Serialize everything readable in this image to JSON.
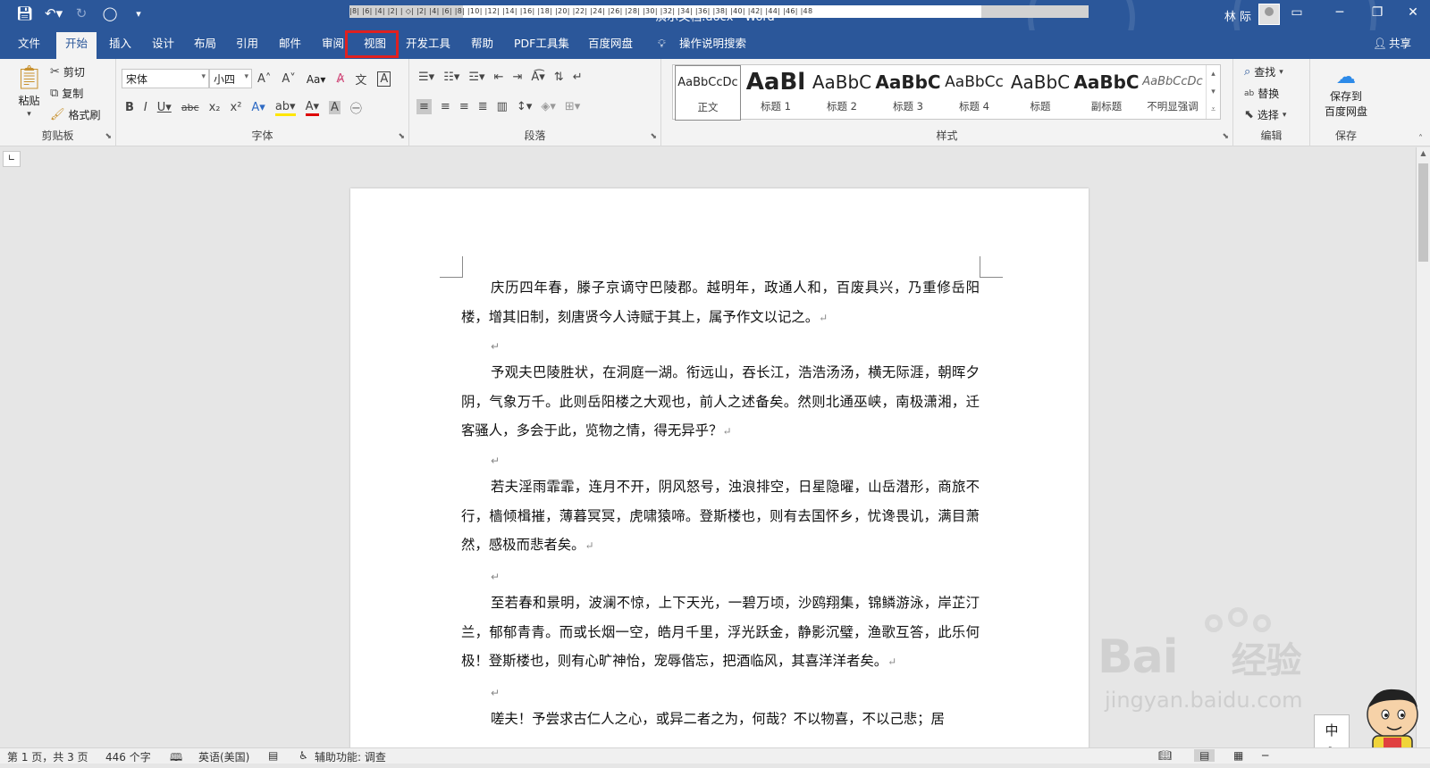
{
  "titlebar": {
    "doc_title": "演示文档.docx  -  Word",
    "user": "林 际",
    "qat_icons": [
      "save-icon",
      "undo-icon",
      "redo-icon",
      "circle-icon",
      "customize-icon"
    ],
    "window_icons": [
      "ribbon-display-icon",
      "minimize-icon",
      "restore-icon",
      "close-icon"
    ]
  },
  "tabs": {
    "items": [
      "文件",
      "开始",
      "插入",
      "设计",
      "布局",
      "引用",
      "邮件",
      "审阅",
      "视图",
      "开发工具",
      "帮助",
      "PDF工具集",
      "百度网盘"
    ],
    "active": "开始",
    "highlighted": "视图",
    "tell_me": "操作说明搜索",
    "share": "共享"
  },
  "clipboard": {
    "paste": "粘贴",
    "cut": "剪切",
    "copy": "复制",
    "format_painter": "格式刷",
    "label": "剪贴板"
  },
  "font": {
    "name": "宋体",
    "size": "小四",
    "change_case": "Aa",
    "label": "字体"
  },
  "paragraph": {
    "label": "段落"
  },
  "styles": {
    "label": "样式",
    "items": [
      {
        "preview": "AaBbCcDc",
        "name": "正文",
        "selected": true
      },
      {
        "preview": "AaBl",
        "name": "标题 1"
      },
      {
        "preview": "AaBbC",
        "name": "标题 2"
      },
      {
        "preview": "AaBbC",
        "name": "标题 3"
      },
      {
        "preview": "AaBbCc",
        "name": "标题 4"
      },
      {
        "preview": "AaBbC",
        "name": "标题"
      },
      {
        "preview": "AaBbC",
        "name": "副标题"
      },
      {
        "preview": "AaBbCcDc",
        "name": "不明显强调"
      }
    ]
  },
  "editing": {
    "find": "查找",
    "replace": "替换",
    "select": "选择",
    "label": "编辑"
  },
  "save": {
    "button": "保存到\n百度网盘",
    "button_line1": "保存到",
    "button_line2": "百度网盘",
    "label": "保存"
  },
  "ruler": {
    "ticks": "|8|  |6|  |4|  |2|  | ◇|  |2|  |4|  |6|  |8|  |10|  |12|  |14|  |16|  |18|  |20|  |22|  |24|  |26|  |28|  |30|  |32|  |34|  |36|  |38|  |40|  |42|  |44|  |46|  |48"
  },
  "document": {
    "paragraphs": [
      "庆历四年春，滕子京谪守巴陵郡。越明年，政通人和，百废具兴，乃重修岳阳楼，增其旧制，刻唐贤今人诗赋于其上，属予作文以记之。",
      "予观夫巴陵胜状，在洞庭一湖。衔远山，吞长江，浩浩汤汤，横无际涯，朝晖夕阴，气象万千。此则岳阳楼之大观也，前人之述备矣。然则北通巫峡，南极潇湘，迁客骚人，多会于此，览物之情，得无异乎？",
      "若夫淫雨霏霏，连月不开，阴风怒号，浊浪排空，日星隐曜，山岳潜形，商旅不行，樯倾楫摧，薄暮冥冥，虎啸猿啼。登斯楼也，则有去国怀乡，忧谗畏讥，满目萧然，感极而悲者矣。",
      "至若春和景明，波澜不惊，上下天光，一碧万顷，沙鸥翔集，锦鳞游泳，岸芷汀兰，郁郁青青。而或长烟一空，皓月千里，浮光跃金，静影沉璧，渔歌互答，此乐何极！登斯楼也，则有心旷神怡，宠辱偕忘，把酒临风，其喜洋洋者矣。",
      "嗟夫！予尝求古仁人之心，或异二者之为，何哉？不以物喜，不以己悲；居"
    ],
    "paragraph_mark": "↵"
  },
  "status": {
    "page": "第 1 页，共 3 页",
    "words": "446 个字",
    "language": "英语(美国)",
    "accessibility": "辅助功能: 调查"
  },
  "watermark": {
    "brand": "Bai",
    "brand2": "经验",
    "url": "jingyan.baidu.com"
  },
  "ime": {
    "char": "中",
    "sub": "°,"
  }
}
